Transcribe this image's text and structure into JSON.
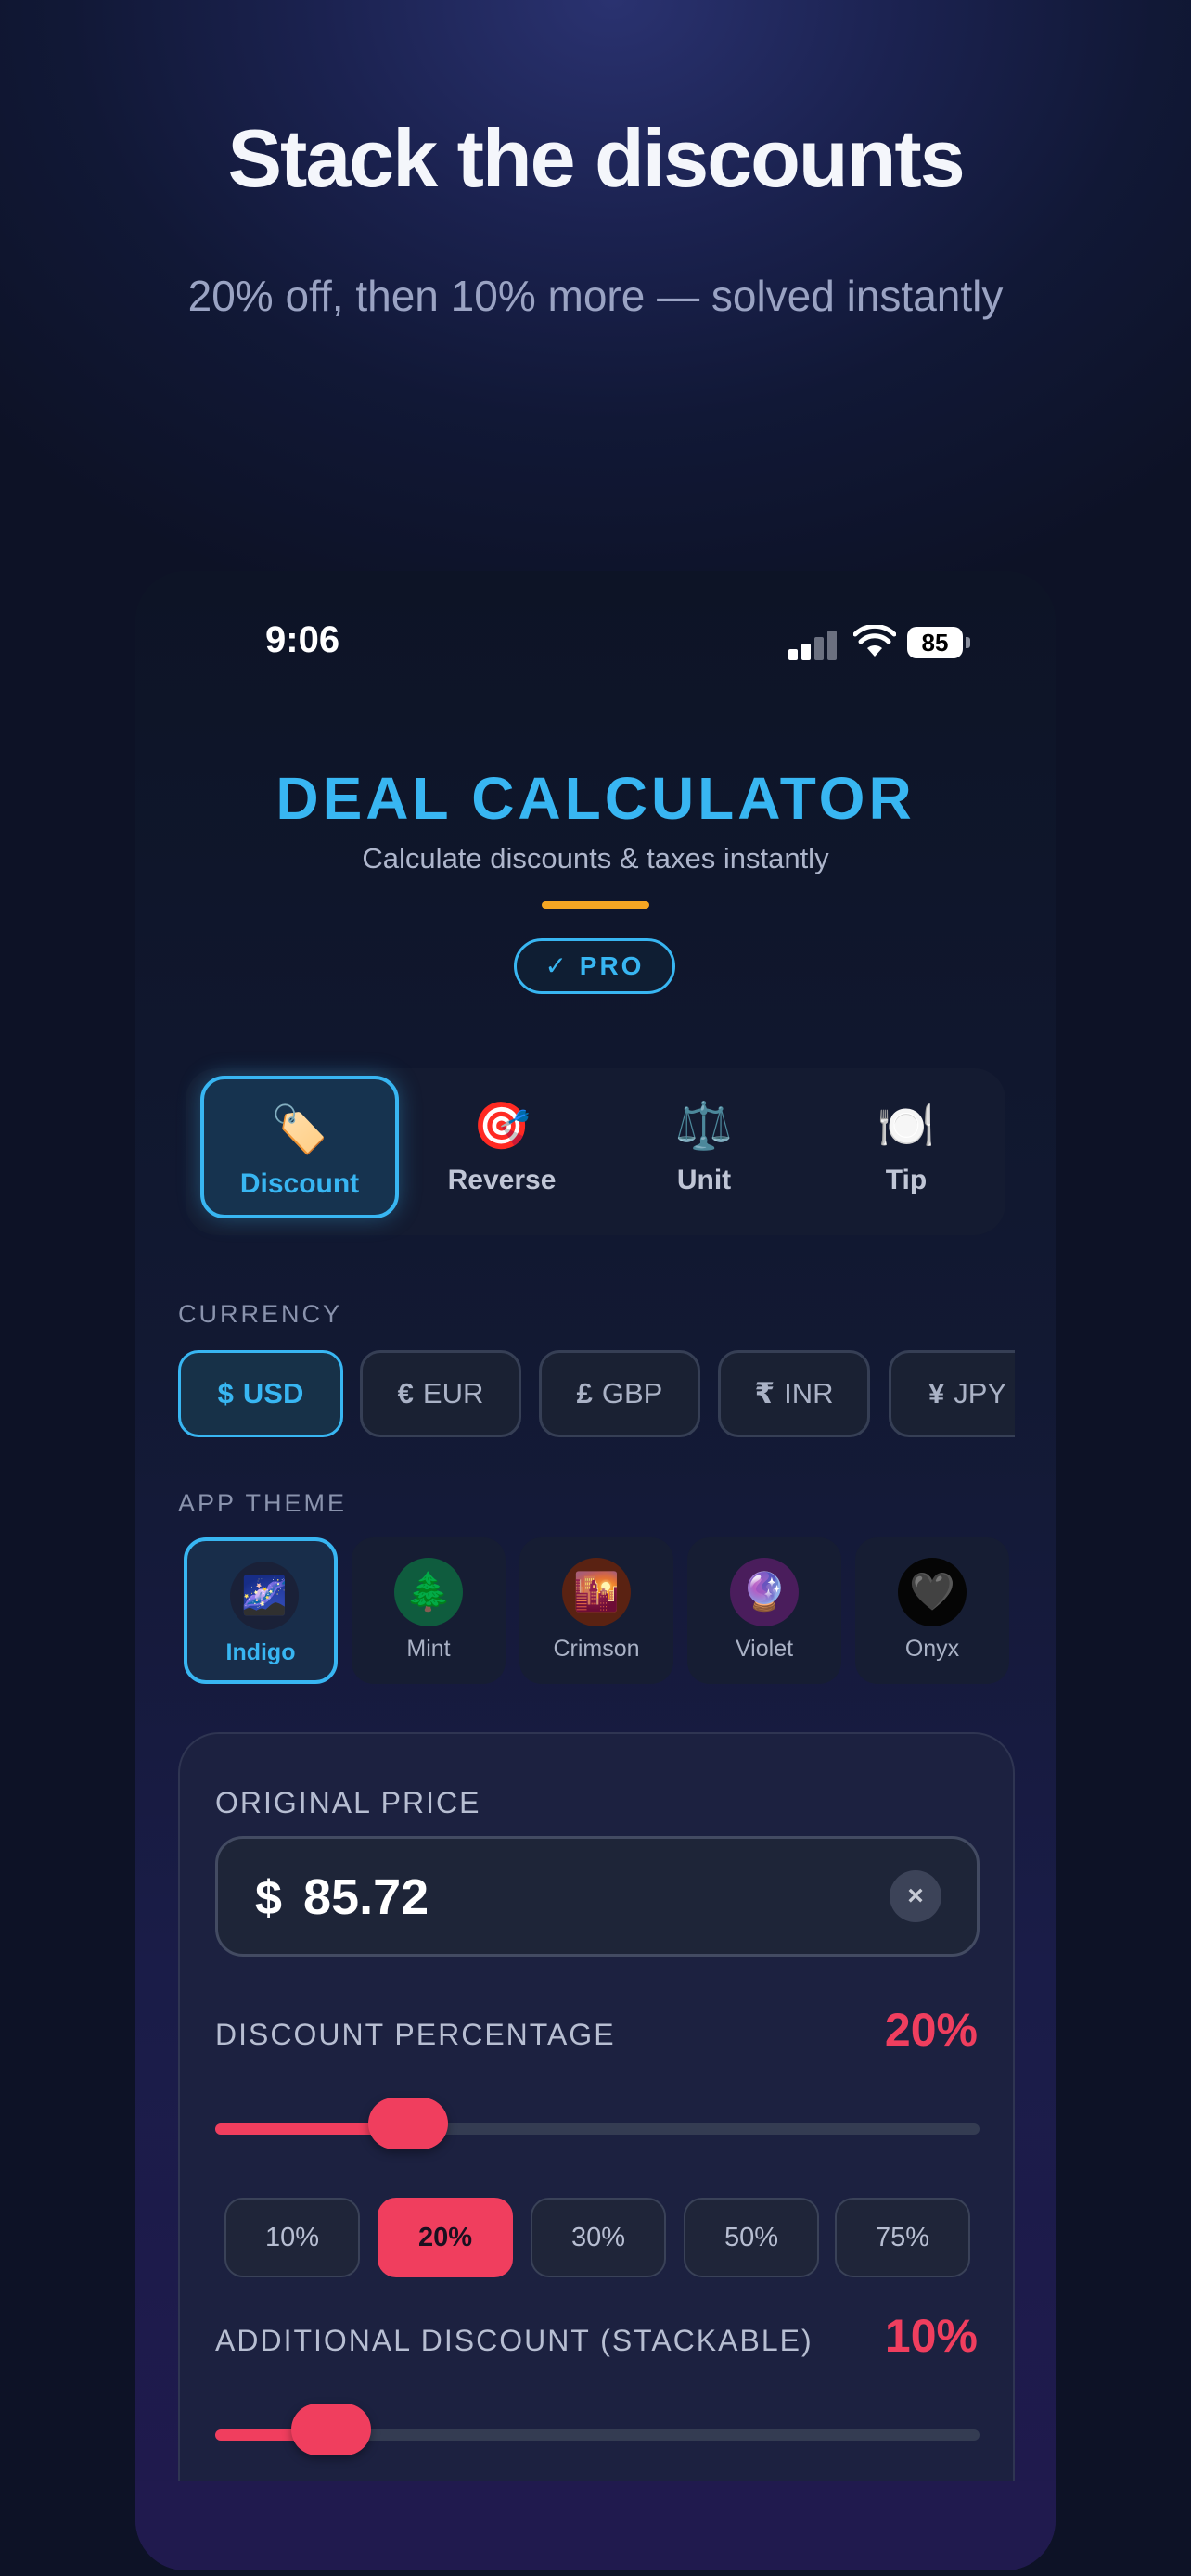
{
  "hero": {
    "title": "Stack the discounts",
    "subtitle": "20% off, then 10% more — solved instantly"
  },
  "status_bar": {
    "time": "9:06",
    "battery": "85"
  },
  "app": {
    "title": "DEAL CALCULATOR",
    "subtitle": "Calculate discounts & taxes instantly",
    "badge": "✓ PRO",
    "accent_color": "#38b6f2",
    "highlight_color": "#f03e5e"
  },
  "modes": [
    {
      "label": "Discount",
      "icon": "🏷️",
      "icon_name": "price-tag-icon",
      "active": true
    },
    {
      "label": "Reverse",
      "icon": "🎯",
      "icon_name": "target-icon",
      "active": false
    },
    {
      "label": "Unit",
      "icon": "⚖️",
      "icon_name": "scales-icon",
      "active": false
    },
    {
      "label": "Tip",
      "icon": "🍽️",
      "icon_name": "plate-icon",
      "active": false
    }
  ],
  "currency": {
    "label": "CURRENCY",
    "options": [
      {
        "symbol": "$",
        "code": "USD",
        "active": true
      },
      {
        "symbol": "€",
        "code": "EUR",
        "active": false
      },
      {
        "symbol": "£",
        "code": "GBP",
        "active": false
      },
      {
        "symbol": "₹",
        "code": "INR",
        "active": false
      },
      {
        "symbol": "¥",
        "code": "JPY",
        "active": false
      }
    ]
  },
  "theme": {
    "label": "APP THEME",
    "options": [
      {
        "name": "Indigo",
        "icon": "🌌",
        "active": true
      },
      {
        "name": "Mint",
        "icon": "🌲",
        "active": false
      },
      {
        "name": "Crimson",
        "icon": "🌇",
        "active": false
      },
      {
        "name": "Violet",
        "icon": "🔮",
        "active": false
      },
      {
        "name": "Onyx",
        "icon": "🖤",
        "active": false
      }
    ]
  },
  "calculator": {
    "original_price_label": "ORIGINAL PRICE",
    "currency_symbol": "$",
    "original_price": "85.72",
    "clear_icon": "×",
    "discount_label": "DISCOUNT PERCENTAGE",
    "discount_value": "20%",
    "discount_fraction": 0.2,
    "discount_presets": [
      "10%",
      "20%",
      "30%",
      "50%",
      "75%"
    ],
    "discount_active_preset": 1,
    "additional_label": "ADDITIONAL DISCOUNT (STACKABLE)",
    "additional_value": "10%",
    "additional_fraction": 0.1,
    "additional_active_preset": 2
  }
}
